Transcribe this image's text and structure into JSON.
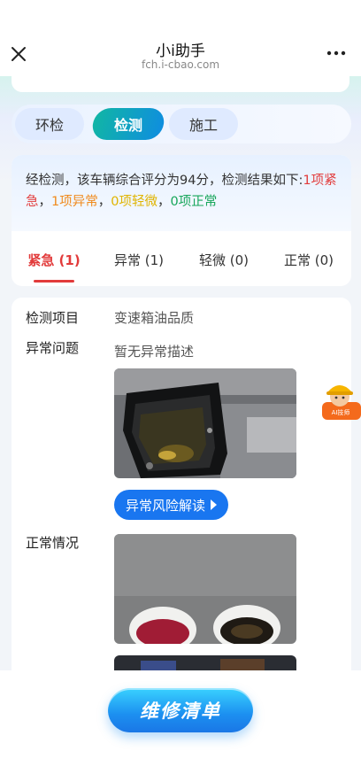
{
  "nav": {
    "title": "小i助手",
    "url": "fch.i-cbao.com"
  },
  "tabs": [
    {
      "label": "环检",
      "active": false
    },
    {
      "label": "检测",
      "active": true
    },
    {
      "label": "施工",
      "active": false
    }
  ],
  "summary": {
    "prefix": "经检测，该车辆综合评分为94分，检测结果如下:",
    "urgent": "1项紧急",
    "sep1": "，",
    "abnormal": "1项异常",
    "sep2": "，",
    "minor": "0项轻微",
    "sep3": "，",
    "normal": "0项正常"
  },
  "subtabs": [
    {
      "label": "紧急 (1)",
      "active": true
    },
    {
      "label": "异常 (1)",
      "active": false
    },
    {
      "label": "轻微 (0)",
      "active": false
    },
    {
      "label": "正常 (0)",
      "active": false
    }
  ],
  "detail": {
    "item_label": "检测项目",
    "item_value": "变速箱油品质",
    "issue_label": "异常问题",
    "issue_value": "暂无异常描述",
    "risk_button": "异常风险解读",
    "normal_label": "正常情况"
  },
  "ai_helper": {
    "label": "AI技师"
  },
  "bottom": {
    "repair_button": "维修清单"
  },
  "colors": {
    "accent": "#1976f0",
    "urgent": "#e23b3b",
    "abnormal": "#f08a1c",
    "minor": "#e0b400",
    "normal": "#17a65a"
  }
}
